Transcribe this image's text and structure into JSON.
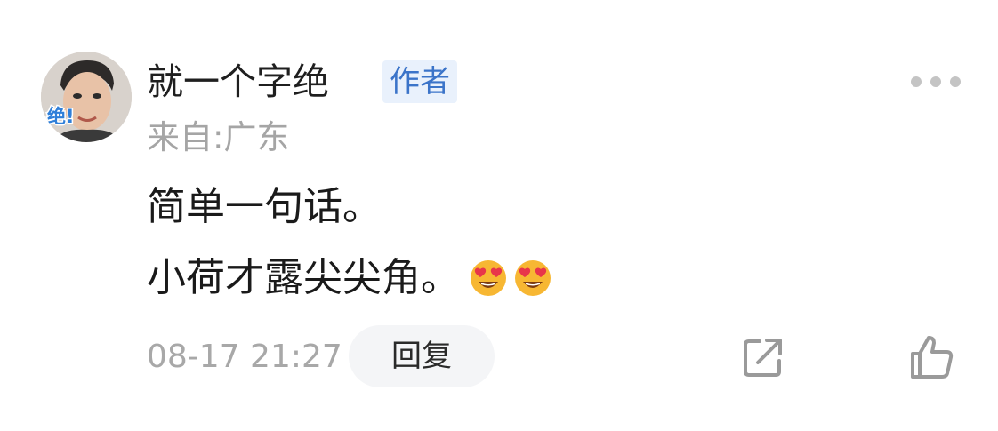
{
  "comment": {
    "avatar": {
      "icon": "user-avatar-photo",
      "overlay_text": "绝!"
    },
    "username": "就一个字绝",
    "badge": "作者",
    "location": "来自:广东",
    "content_lines": [
      "简单一句话。",
      "小荷才露尖尖角。"
    ],
    "emojis": [
      "heart-eyes-emoji",
      "heart-eyes-emoji"
    ],
    "timestamp": "08-17 21:27",
    "reply_label": "回复",
    "icons": {
      "more": "more-dots-icon",
      "share": "share-icon",
      "like": "thumbs-up-icon"
    }
  },
  "colors": {
    "badge_bg": "#e9f1fc",
    "badge_text": "#3b74c9",
    "muted_text": "#a5a5a5",
    "icon_gray": "#9a9a9a"
  }
}
